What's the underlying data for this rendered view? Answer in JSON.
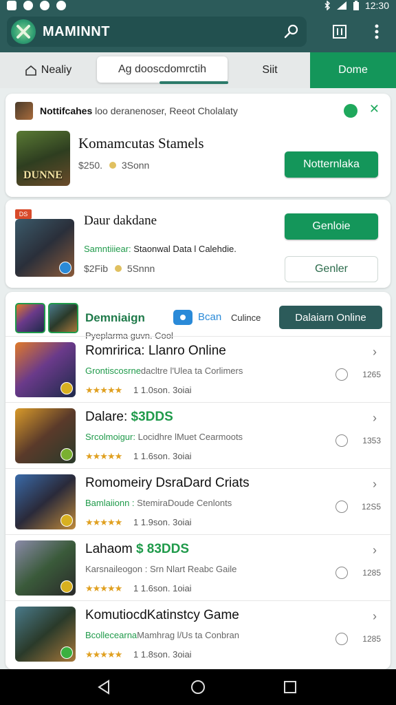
{
  "status_bar": {
    "time": "12:30"
  },
  "app_bar": {
    "title": "MAMINNT"
  },
  "tabs": [
    {
      "label": "Nealiy"
    },
    {
      "label": "Ag dooscdomrctih"
    },
    {
      "label": "Siit"
    },
    {
      "label": "Dome"
    }
  ],
  "notification_card": {
    "header_bold": "Nottifcahes",
    "header_text": "loo deranenoser, Reeot Cholalaty",
    "title": "Komamcutas Stamels",
    "price": "$250.",
    "time": "3Sonn",
    "button": "Notternlaka",
    "thumb_label": "DUNNE"
  },
  "feature_card": {
    "tag": "DS",
    "title": "Daur dakdane",
    "subtitle_green": "Samntiiiear:",
    "subtitle_text": "Staonwal Data l Calehdie.",
    "price": "$2Fib",
    "time": "5Snnn",
    "primary_button": "Genloie",
    "secondary_button": "Genler"
  },
  "section": {
    "title": "Demniaign",
    "subtitle": "Pyeplarma guvn. Cool",
    "scan_label": "Bcan",
    "scan_extra": "Culince",
    "online_button": "Dalaiarn Online"
  },
  "list": [
    {
      "title": "Romririca: Llanro Online",
      "title_accent": "",
      "sub_green": "Grontiscosrne",
      "sub_text": "dacltre l'Ulea ta Corlimers",
      "stars": "★★★★★",
      "meta": "1 1.0son. 3oiai",
      "count": "1265"
    },
    {
      "title": "Dalare:",
      "title_accent": "$3DDS",
      "sub_green": "Srcolmoigur:",
      "sub_text": "Locidhre lMuet Cearmoots",
      "stars": "★★★★★",
      "meta": "1 1.6son. 3oiai",
      "count": "1353"
    },
    {
      "title": "Romomeiry DsraDard Criats",
      "title_accent": "",
      "sub_green": "Bamlaiionn :",
      "sub_text": "StemiraDoude Cenlonts",
      "stars": "★★★★★",
      "meta": "1 1.9son. 3oiai",
      "count": "12S5"
    },
    {
      "title": "Lahaom",
      "title_accent": "$ 83DDS",
      "sub_green": "",
      "sub_text": "Karsnaileogon : Srn Nlart Reabc Gaile",
      "stars": "★★★★★",
      "meta": "1 1.6son. 1oiai",
      "count": "1285"
    },
    {
      "title": "KomutiocdKatinstcy Game",
      "title_accent": "",
      "sub_green": "Bcollecearna",
      "sub_text": "Mamhrag l/Us ta Conbran",
      "stars": "★★★★★",
      "meta": "1 1.8son. 3oiai",
      "count": "1285"
    }
  ]
}
